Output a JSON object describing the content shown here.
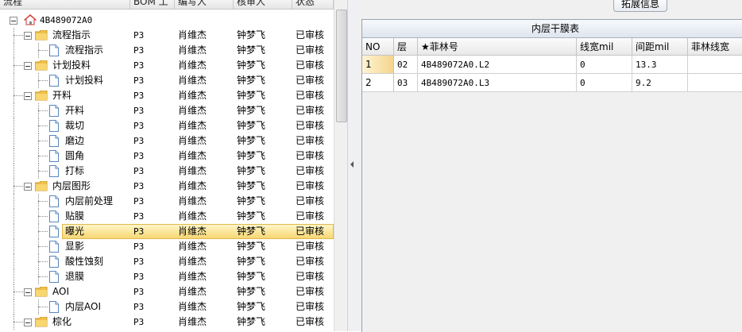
{
  "tree": {
    "headers": [
      "流程",
      "BOM 工",
      "编写人",
      "核审人",
      "状态"
    ],
    "root_label": "4B489072A0",
    "rows": [
      {
        "name": "流程指示",
        "bom": "P3",
        "editor": "肖维杰",
        "reviewer": "钟梦飞",
        "status": "已审核",
        "level": 1,
        "icon": "folder-icon"
      },
      {
        "name": "流程指示",
        "bom": "P3",
        "editor": "肖维杰",
        "reviewer": "钟梦飞",
        "status": "已审核",
        "level": 2,
        "icon": "document-icon"
      },
      {
        "name": "计划投料",
        "bom": "P3",
        "editor": "肖维杰",
        "reviewer": "钟梦飞",
        "status": "已审核",
        "level": 1,
        "icon": "folder-icon"
      },
      {
        "name": "计划投料",
        "bom": "P3",
        "editor": "肖维杰",
        "reviewer": "钟梦飞",
        "status": "已审核",
        "level": 2,
        "icon": "document-icon"
      },
      {
        "name": "开料",
        "bom": "P3",
        "editor": "肖维杰",
        "reviewer": "钟梦飞",
        "status": "已审核",
        "level": 1,
        "icon": "folder-icon"
      },
      {
        "name": "开料",
        "bom": "P3",
        "editor": "肖维杰",
        "reviewer": "钟梦飞",
        "status": "已审核",
        "level": 2,
        "icon": "document-icon"
      },
      {
        "name": "裁切",
        "bom": "P3",
        "editor": "肖维杰",
        "reviewer": "钟梦飞",
        "status": "已审核",
        "level": 2,
        "icon": "document-icon"
      },
      {
        "name": "磨边",
        "bom": "P3",
        "editor": "肖维杰",
        "reviewer": "钟梦飞",
        "status": "已审核",
        "level": 2,
        "icon": "document-icon"
      },
      {
        "name": "圆角",
        "bom": "P3",
        "editor": "肖维杰",
        "reviewer": "钟梦飞",
        "status": "已审核",
        "level": 2,
        "icon": "document-icon"
      },
      {
        "name": "打标",
        "bom": "P3",
        "editor": "肖维杰",
        "reviewer": "钟梦飞",
        "status": "已审核",
        "level": 2,
        "icon": "document-icon"
      },
      {
        "name": "内层图形",
        "bom": "P3",
        "editor": "肖维杰",
        "reviewer": "钟梦飞",
        "status": "已审核",
        "level": 1,
        "icon": "folder-icon"
      },
      {
        "name": "内层前处理",
        "bom": "P3",
        "editor": "肖维杰",
        "reviewer": "钟梦飞",
        "status": "已审核",
        "level": 2,
        "icon": "document-icon"
      },
      {
        "name": "贴膜",
        "bom": "P3",
        "editor": "肖维杰",
        "reviewer": "钟梦飞",
        "status": "已审核",
        "level": 2,
        "icon": "document-icon"
      },
      {
        "name": "曝光",
        "bom": "P3",
        "editor": "肖维杰",
        "reviewer": "钟梦飞",
        "status": "已审核",
        "level": 2,
        "icon": "document-icon",
        "selected": true
      },
      {
        "name": "显影",
        "bom": "P3",
        "editor": "肖维杰",
        "reviewer": "钟梦飞",
        "status": "已审核",
        "level": 2,
        "icon": "document-icon"
      },
      {
        "name": "酸性蚀刻",
        "bom": "P3",
        "editor": "肖维杰",
        "reviewer": "钟梦飞",
        "status": "已审核",
        "level": 2,
        "icon": "document-icon"
      },
      {
        "name": "退膜",
        "bom": "P3",
        "editor": "肖维杰",
        "reviewer": "钟梦飞",
        "status": "已审核",
        "level": 2,
        "icon": "document-icon"
      },
      {
        "name": "AOI",
        "bom": "P3",
        "editor": "肖维杰",
        "reviewer": "钟梦飞",
        "status": "已审核",
        "level": 1,
        "icon": "folder-icon"
      },
      {
        "name": "内层AOI",
        "bom": "P3",
        "editor": "肖维杰",
        "reviewer": "钟梦飞",
        "status": "已审核",
        "level": 2,
        "icon": "document-icon"
      },
      {
        "name": "棕化",
        "bom": "P3",
        "editor": "肖维杰",
        "reviewer": "钟梦飞",
        "status": "已审核",
        "level": 1,
        "icon": "folder-icon"
      }
    ]
  },
  "right_panel": {
    "tab_label": "拓展信息",
    "grid_title": "内层干膜表",
    "columns": [
      "NO",
      "层",
      "★菲林号",
      "线宽mil",
      "间距mil",
      "菲林线宽"
    ],
    "rows": [
      {
        "no": "1",
        "layer": "02",
        "film": "4B489072A0.L2",
        "line_width": "0",
        "spacing": "13.3",
        "film_width": ""
      },
      {
        "no": "2",
        "layer": "03",
        "film": "4B489072A0.L3",
        "line_width": "0",
        "spacing": "9.2",
        "film_width": ""
      }
    ]
  },
  "colors": {
    "selection": "#f7d774",
    "folder": "#f0c24a",
    "home_roof": "#d8382e"
  }
}
